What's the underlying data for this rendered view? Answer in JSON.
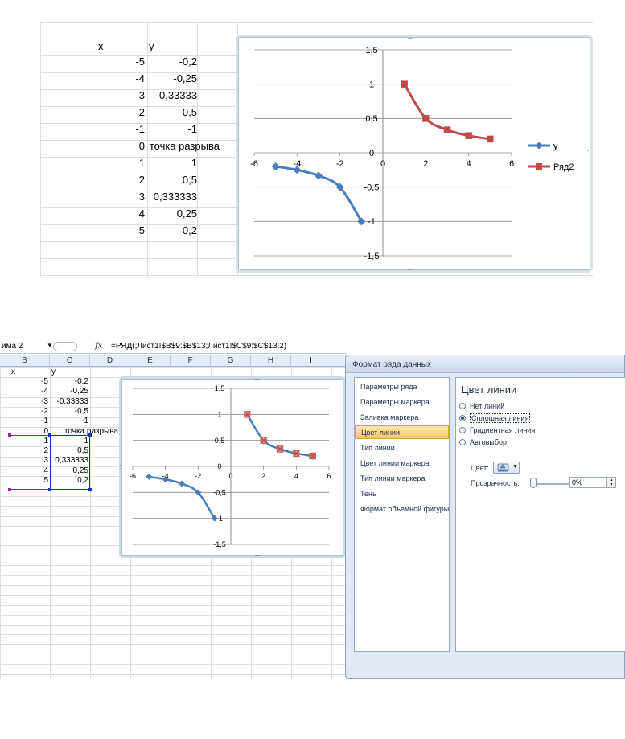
{
  "top": {
    "table": {
      "header_x": "x",
      "header_y": "y",
      "rows": [
        {
          "x": "-5",
          "y": "-0,2"
        },
        {
          "x": "-4",
          "y": "-0,25"
        },
        {
          "x": "-3",
          "y": "-0,33333"
        },
        {
          "x": "-2",
          "y": "-0,5"
        },
        {
          "x": "-1",
          "y": "-1"
        },
        {
          "x": "0",
          "y": "точка разрыва"
        },
        {
          "x": "1",
          "y": "1"
        },
        {
          "x": "2",
          "y": "0,5"
        },
        {
          "x": "3",
          "y": "0,333333"
        },
        {
          "x": "4",
          "y": "0,25"
        },
        {
          "x": "5",
          "y": "0,2"
        }
      ]
    },
    "chart": {
      "y_ticks": [
        "1,5",
        "1",
        "0,5",
        "0",
        "-0,5",
        "-1",
        "-1,5"
      ],
      "x_ticks": [
        "-6",
        "-4",
        "-2",
        "0",
        "2",
        "4",
        "6"
      ],
      "legend": [
        {
          "label": "y",
          "color": "#4a7ebb",
          "marker": "diamond"
        },
        {
          "label": "Ряд2",
          "color": "#be4b48",
          "marker": "square"
        }
      ],
      "handle": "....",
      "side_handle": ":"
    }
  },
  "bottom": {
    "name_box": "има 2",
    "name_box_arrow": "▼",
    "formula_circle": "⌐",
    "fx": "fx",
    "formula": "=РЯД(;Лист1!$B$9:$B$13;Лист1!$C$9:$C$13;2)",
    "columns": [
      "B",
      "C",
      "D",
      "E",
      "F",
      "G",
      "H",
      "I"
    ],
    "table": {
      "header_x": "x",
      "header_y": "y",
      "rows": [
        {
          "x": "-5",
          "y": "-0,2"
        },
        {
          "x": "-4",
          "y": "-0,25"
        },
        {
          "x": "-3",
          "y": "-0,33333"
        },
        {
          "x": "-2",
          "y": "-0,5"
        },
        {
          "x": "-1",
          "y": "-1"
        },
        {
          "x": "0",
          "y": "точка разрыва"
        },
        {
          "x": "1",
          "y": "1"
        },
        {
          "x": "2",
          "y": "0,5"
        },
        {
          "x": "3",
          "y": "0,333333"
        },
        {
          "x": "4",
          "y": "0,25"
        },
        {
          "x": "5",
          "y": "0,2"
        }
      ]
    },
    "chart": {
      "y_ticks": [
        "1,5",
        "1",
        "0,5",
        "0",
        "-0,5",
        "-1",
        "-1,5"
      ],
      "x_ticks": [
        "-6",
        "-4",
        "-2",
        "0",
        "2",
        "4",
        "6"
      ],
      "handle": "....",
      "side_handle": ":"
    },
    "dialog": {
      "title": "Формат ряда данных",
      "nav": [
        "Параметры ряда",
        "Параметры маркера",
        "Заливка маркера",
        "Цвет линии",
        "Тип линии",
        "Цвет линии маркера",
        "Тип линии маркера",
        "Тень",
        "Формат объемной фигуры"
      ],
      "active_nav": "Цвет линии",
      "heading": "Цвет линии",
      "options": [
        {
          "label": "Нет линий",
          "selected": false
        },
        {
          "label": "Сплошная линия",
          "selected": true
        },
        {
          "label": "Градиентная линия",
          "selected": false
        },
        {
          "label": "Автовыбор",
          "selected": false
        }
      ],
      "color_label": "Цвет:",
      "color_arrow": "▼",
      "transparency_label": "Прозрачность:",
      "transparency_value": "0%",
      "spin_up": "▲",
      "spin_down": "▼"
    }
  },
  "chart_data": [
    {
      "type": "scatter",
      "title": "",
      "xlabel": "",
      "ylabel": "",
      "xlim": [
        -6,
        6
      ],
      "ylim": [
        -1.5,
        1.5
      ],
      "series": [
        {
          "name": "y",
          "x": [
            -5,
            -4,
            -3,
            -2,
            -1
          ],
          "y": [
            -0.2,
            -0.25,
            -0.33333,
            -0.5,
            -1
          ],
          "color": "#4a7ebb"
        },
        {
          "name": "Ряд2",
          "x": [
            1,
            2,
            3,
            4,
            5
          ],
          "y": [
            1,
            0.5,
            0.333333,
            0.25,
            0.2
          ],
          "color": "#be4b48"
        }
      ],
      "legend": "right",
      "grid": true
    },
    {
      "type": "scatter",
      "title": "",
      "xlabel": "",
      "ylabel": "",
      "xlim": [
        -6,
        6
      ],
      "ylim": [
        -1.5,
        1.5
      ],
      "series": [
        {
          "x": [
            -5,
            -4,
            -3,
            -2,
            -1
          ],
          "y": [
            -0.2,
            -0.25,
            -0.33333,
            -0.5,
            -1
          ],
          "color": "#4a7ebb"
        },
        {
          "x": [
            1,
            2,
            3,
            4,
            5
          ],
          "y": [
            1,
            0.5,
            0.333333,
            0.25,
            0.2
          ],
          "color": "#4a7ebb",
          "marker_color": "#be4b48"
        }
      ],
      "legend": "none",
      "grid": true
    }
  ]
}
